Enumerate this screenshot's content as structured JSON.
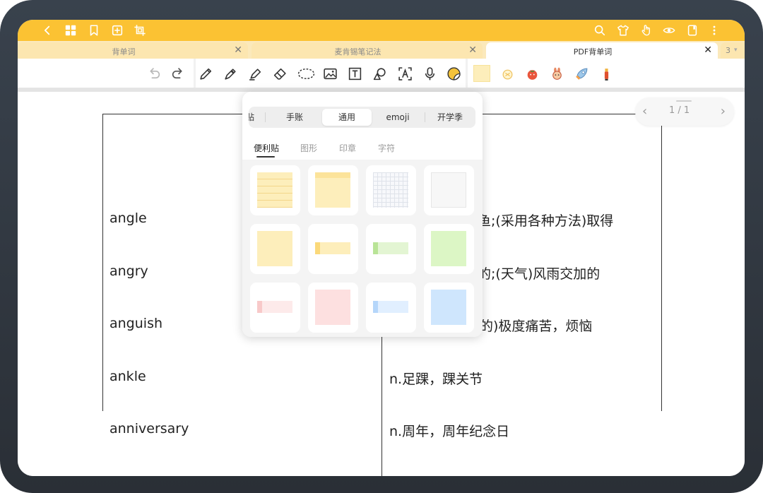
{
  "topbar": {
    "icons": [
      "back-icon",
      "grid-icon",
      "bookmark-icon",
      "add-page-icon",
      "crop-icon",
      "search-icon",
      "tshirt-icon",
      "hand-icon",
      "eye-icon",
      "book-icon",
      "more-icon"
    ]
  },
  "tabs": [
    {
      "label": "背单词",
      "close": "✕"
    },
    {
      "label": "麦肯锡笔记法",
      "close": "✕"
    },
    {
      "label": "PDF背单词",
      "close": "✕"
    }
  ],
  "tab_count": {
    "label": "3",
    "arrow": "▾"
  },
  "toolbar": {
    "tools": [
      "undo-icon",
      "redo-icon",
      "pen-icon",
      "fountain-pen-icon",
      "highlighter-icon",
      "eraser-icon",
      "lasso-icon",
      "image-icon",
      "text-box-icon",
      "shape-icon",
      "ocr-text-icon",
      "microphone-icon",
      "sticker-icon"
    ],
    "quick_stickers": [
      "sticky-note-icon",
      "lemon-sticker-icon",
      "tomato-sticker-icon",
      "bunny-sticker-icon",
      "rocket-sticker-icon",
      "marker-sticker-icon"
    ]
  },
  "pager": {
    "prev": "‹",
    "count": "1 / 1",
    "next": "›"
  },
  "words": [
    "angle",
    "angry",
    "anguish",
    "ankle",
    "anniversary"
  ],
  "definitions": [
    "钓鱼;(采用各种方法)取得",
    "怒的;(天气)风雨交加的",
    "的)极度痛苦，烦恼",
    "n.足踝，踝关节",
    "n.周年，周年纪念日"
  ],
  "sticker_panel": {
    "segments": [
      "贴",
      "手账",
      "通用",
      "emoji",
      "开学季"
    ],
    "active_segment": "通用",
    "subtabs": [
      "便利贴",
      "图形",
      "印章",
      "字符"
    ],
    "active_subtab": "便利贴",
    "notes": [
      "lined-yellow-note",
      "yellow-tab-note",
      "grid-note",
      "plain-white-note",
      "yellow-square-note",
      "yellow-strip-note",
      "green-strip-note",
      "green-square-note",
      "pink-strip-note",
      "pink-square-note",
      "blue-strip-note",
      "blue-square-note"
    ]
  },
  "colors": {
    "accent": "#fbc233",
    "tab_bar": "#fbe9bb"
  }
}
